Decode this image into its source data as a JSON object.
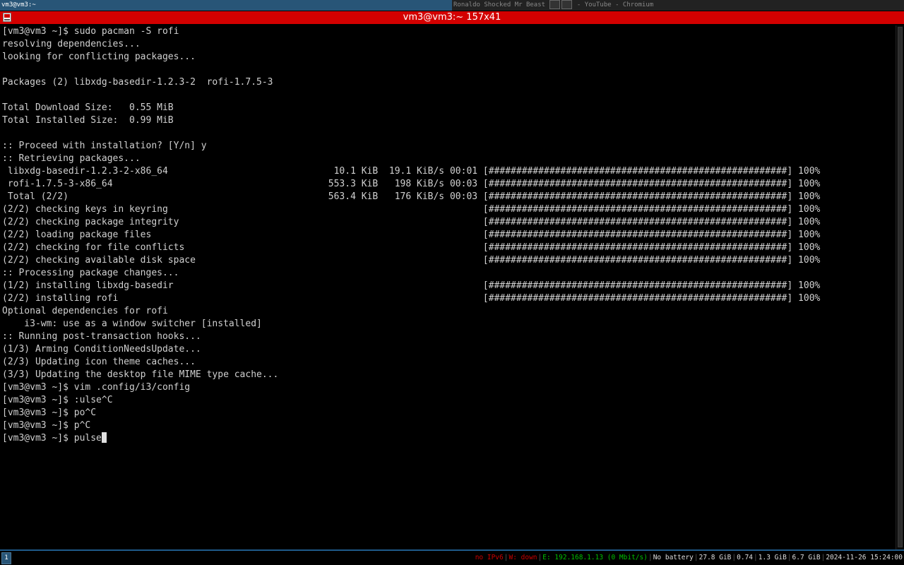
{
  "tabs": {
    "terminal": "vm3@vm3:~",
    "browser_left": "Ronaldo Shocked Mr Beast",
    "browser_right": "- YouTube - Chromium"
  },
  "window": {
    "title": "vm3@vm3:~ 157x41"
  },
  "terminal": {
    "lines": [
      "[vm3@vm3 ~]$ sudo pacman -S rofi",
      "resolving dependencies...",
      "looking for conflicting packages...",
      "",
      "Packages (2) libxdg-basedir-1.2.3-2  rofi-1.7.5-3",
      "",
      "Total Download Size:   0.55 MiB",
      "Total Installed Size:  0.99 MiB",
      "",
      ":: Proceed with installation? [Y/n] y",
      ":: Retrieving packages...",
      " libxdg-basedir-1.2.3-2-x86_64                              10.1 KiB  19.1 KiB/s 00:01 [######################################################] 100%",
      " rofi-1.7.5-3-x86_64                                       553.3 KiB   198 KiB/s 00:03 [######################################################] 100%",
      " Total (2/2)                                               563.4 KiB   176 KiB/s 00:03 [######################################################] 100%",
      "(2/2) checking keys in keyring                                                         [######################################################] 100%",
      "(2/2) checking package integrity                                                       [######################################################] 100%",
      "(2/2) loading package files                                                            [######################################################] 100%",
      "(2/2) checking for file conflicts                                                      [######################################################] 100%",
      "(2/2) checking available disk space                                                    [######################################################] 100%",
      ":: Processing package changes...",
      "(1/2) installing libxdg-basedir                                                        [######################################################] 100%",
      "(2/2) installing rofi                                                                  [######################################################] 100%",
      "Optional dependencies for rofi",
      "    i3-wm: use as a window switcher [installed]",
      ":: Running post-transaction hooks...",
      "(1/3) Arming ConditionNeedsUpdate...",
      "(2/3) Updating icon theme caches...",
      "(3/3) Updating the desktop file MIME type cache...",
      "[vm3@vm3 ~]$ vim .config/i3/config",
      "[vm3@vm3 ~]$ :ulse^C",
      "[vm3@vm3 ~]$ po^C",
      "[vm3@vm3 ~]$ p^C"
    ],
    "current_prompt": "[vm3@vm3 ~]$ ",
    "current_input": "pulse"
  },
  "statusbar": {
    "workspace": "1",
    "items": [
      {
        "text": "no IPv6",
        "color": "#cc0000"
      },
      {
        "text": "W: down",
        "color": "#cc0000"
      },
      {
        "text": "E: 192.168.1.13 (0 Mbit/s)",
        "color": "#00c000"
      },
      {
        "text": "No battery",
        "color": "#dddddd"
      },
      {
        "text": "27.8 GiB",
        "color": "#dddddd"
      },
      {
        "text": "0.74",
        "color": "#dddddd"
      },
      {
        "text": "1.3 GiB",
        "color": "#dddddd"
      },
      {
        "text": "6.7 GiB",
        "color": "#dddddd"
      },
      {
        "text": "2024-11-26 15:24:00",
        "color": "#dddddd"
      }
    ]
  },
  "colors": {
    "title_bar": "#d30000",
    "focused_tab": "#285577",
    "terminal_bg": "#000000",
    "terminal_fg": "#d0d0d0"
  }
}
